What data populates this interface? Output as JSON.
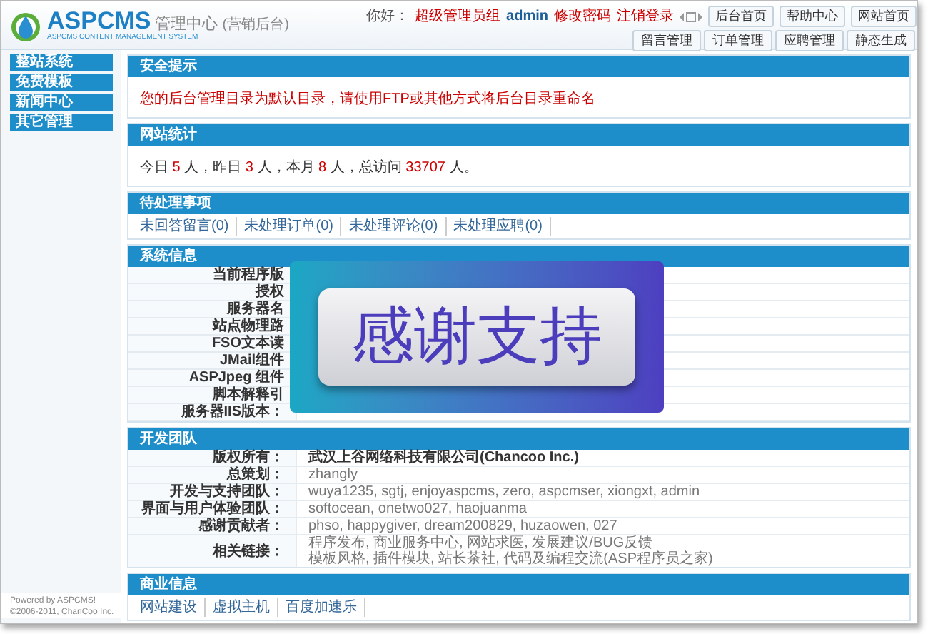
{
  "header": {
    "logo_title": "ASPCMS",
    "logo_subtitle": "管理中心",
    "logo_tag": "(营销后台)",
    "logo_tagline": "ASPCMS CONTENT MANAGEMENT SYSTEM",
    "greeting": "你好：",
    "role": "超级管理员组",
    "user": "admin",
    "links": [
      "修改密码",
      "注销登录"
    ],
    "top_buttons": [
      "后台首页",
      "帮助中心",
      "网站首页"
    ],
    "tabs": [
      "留言管理",
      "订单管理",
      "应聘管理",
      "静态生成"
    ]
  },
  "sidebar": {
    "items": [
      "整站系统",
      "免费模板",
      "新闻中心",
      "其它管理"
    ],
    "footer": [
      "Powered by ASPCMS!",
      "©2006-2011, ChanCoo Inc."
    ]
  },
  "sections": [
    {
      "kind": "notice",
      "title": "安全提示",
      "text": "您的后台管理目录为默认目录，请使用FTP或其他方式将后台目录重命名"
    },
    {
      "kind": "stats",
      "title": "网站统计",
      "items": [
        {
          "label": "今日",
          "value": "5",
          "unit": "人"
        },
        {
          "label": "，昨日",
          "value": "3",
          "unit": "人"
        },
        {
          "label": "，本月",
          "value": "8",
          "unit": "人"
        },
        {
          "label": "，总访问",
          "value": "33707",
          "unit": "人。"
        }
      ]
    },
    {
      "kind": "links",
      "title": "待处理事项",
      "items": [
        "未回答留言(0)",
        "未处理订单(0)",
        "未处理评论(0)",
        "未处理应聘(0)"
      ]
    },
    {
      "kind": "table",
      "title": "系统信息",
      "overlay": {
        "text": "感谢支持"
      },
      "rows": [
        {
          "label": "当前程序版",
          "values": []
        },
        {
          "label": "授权",
          "values": []
        },
        {
          "label": "服务器名",
          "values": []
        },
        {
          "label": "站点物理路",
          "values": []
        },
        {
          "label": "FSO文本读",
          "values": []
        },
        {
          "label": "JMail组件",
          "values": []
        },
        {
          "label": "ASPJpeg 组件",
          "values": []
        },
        {
          "label": "脚本解释引",
          "values": []
        },
        {
          "label": "服务器IIS版本：",
          "values": []
        }
      ]
    },
    {
      "kind": "table",
      "title": "开发团队",
      "rows": [
        {
          "label": "版权所有：",
          "values": [
            "武汉上谷网络科技有限公司(Chancoo Inc.)"
          ],
          "bold": true
        },
        {
          "label": "总策划：",
          "values": [
            "zhangly"
          ],
          "bold": false
        },
        {
          "label": "开发与支持团队：",
          "values": [
            "wuya1235, sgtj, enjoyaspcms, zero, aspcmser, xiongxt, admin"
          ],
          "bold": false
        },
        {
          "label": "界面与用户体验团队：",
          "values": [
            "softocean, onetwo027, haojuanma"
          ],
          "bold": false
        },
        {
          "label": "感谢贡献者：",
          "values": [
            "phso, happygiver, dream200829, huzaowen, 027"
          ],
          "bold": false
        },
        {
          "label": "相关链接：",
          "values": [
            "程序发布, 商业服务中心, 网站求医, 发展建议/BUG反馈",
            "模板风格, 插件模块, 站长茶社, 代码及编程交流(ASP程序员之家)"
          ],
          "bold": false
        }
      ]
    },
    {
      "kind": "links",
      "title": "商业信息",
      "items": [
        "网站建设",
        "虚拟主机",
        "百度加速乐"
      ]
    }
  ]
}
